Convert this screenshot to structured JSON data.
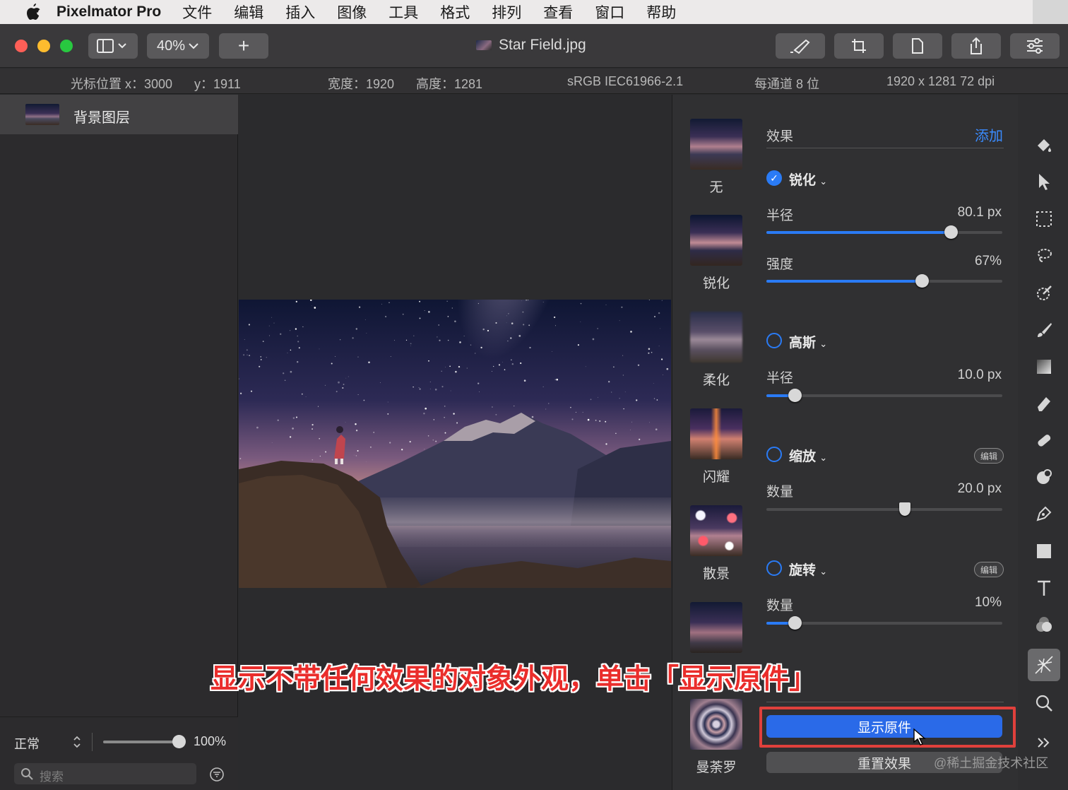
{
  "menubar": {
    "app_name": "Pixelmator Pro",
    "items": [
      "文件",
      "编辑",
      "插入",
      "图像",
      "工具",
      "格式",
      "排列",
      "查看",
      "窗口",
      "帮助"
    ]
  },
  "toolbar": {
    "zoom": "40%",
    "add_label": "+",
    "doc_title": "Star Field.jpg"
  },
  "infobar": {
    "cursor_x": "光标位置 x：3000",
    "cursor_y": "y：1911",
    "width": "宽度：1920",
    "height": "高度：1281",
    "color_profile": "sRGB IEC61966-2.1",
    "bit_depth": "每通道 8 位",
    "dimensions": "1920 x 1281 72 dpi"
  },
  "layers": {
    "items": [
      {
        "name": "背景图层"
      }
    ],
    "blend_mode": "正常",
    "opacity": "100%",
    "opacity_value": 1.0,
    "search_placeholder": "搜索"
  },
  "effects": {
    "header": "效果",
    "add_label": "添加",
    "presets": [
      {
        "label": "无"
      },
      {
        "label": "锐化"
      },
      {
        "label": "柔化"
      },
      {
        "label": "闪耀"
      },
      {
        "label": "散景"
      },
      {
        "label": ""
      },
      {
        "label": "曼荼罗"
      }
    ],
    "sharpen": {
      "name": "锐化",
      "enabled": true,
      "radius_label": "半径",
      "radius_value": "80.1 px",
      "radius_level": 0.78,
      "intensity_label": "强度",
      "intensity_value": "67%",
      "intensity_level": 0.66
    },
    "gaussian": {
      "name": "高斯",
      "enabled": false,
      "radius_label": "半径",
      "radius_value": "10.0 px",
      "radius_level": 0.12
    },
    "zoom": {
      "name": "缩放",
      "enabled": false,
      "edit_label": "编辑",
      "amount_label": "数量",
      "amount_value": "20.0 px",
      "amount_level": 0.59
    },
    "spin": {
      "name": "旋转",
      "enabled": false,
      "edit_label": "编辑",
      "amount_label": "数量",
      "amount_value": "10%",
      "amount_level": 0.12
    },
    "show_original": "显示原件",
    "reset": "重置效果"
  },
  "annotation": "显示不带任何效果的对象外观，单击「显示原件」",
  "watermark": "@稀土掘金技术社区",
  "colors": {
    "accent": "#2a7bf5",
    "highlight_red": "#e0403c",
    "annotation_red": "#ea2d2b"
  }
}
